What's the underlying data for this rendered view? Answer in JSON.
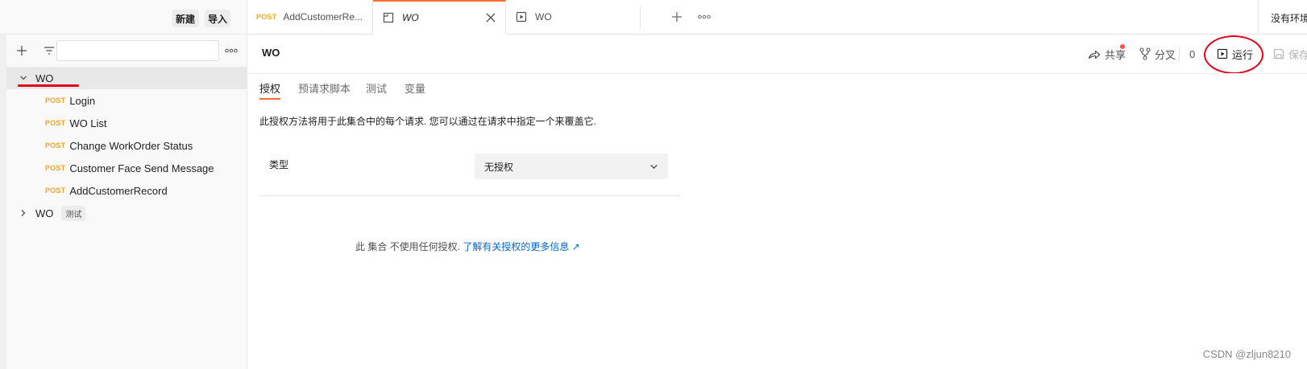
{
  "topbar": {
    "new_label": "新建",
    "import_label": "导入",
    "tabs": [
      {
        "method": "POST",
        "label": "AddCustomerRe..."
      },
      {
        "label": "WO"
      },
      {
        "label": "WO"
      }
    ],
    "env_label": "没有环境"
  },
  "sidebar": {
    "collections": [
      {
        "name": "WO",
        "expanded": true,
        "requests": [
          {
            "method": "POST",
            "name": "Login"
          },
          {
            "method": "POST",
            "name": "WO List"
          },
          {
            "method": "POST",
            "name": "Change WorkOrder Status"
          },
          {
            "method": "POST",
            "name": "Customer Face Send Message"
          },
          {
            "method": "POST",
            "name": "AddCustomerRecord"
          }
        ]
      },
      {
        "name": "WO",
        "badge": "测试",
        "expanded": false
      }
    ]
  },
  "main": {
    "title": "WO",
    "actions": {
      "share": "共享",
      "fork": "分叉",
      "fork_count": "0",
      "run": "运行",
      "save": "保存"
    },
    "tabs": [
      "授权",
      "预请求脚本",
      "测试",
      "变量"
    ],
    "active_tab": "授权",
    "auth": {
      "description": "此授权方法将用于此集合中的每个请求. 您可以通过在请求中指定一个来覆盖它.",
      "type_label": "类型",
      "type_value": "无授权",
      "info_text": "此 集合 不使用任何授权.",
      "info_link": "了解有关授权的更多信息 ↗"
    }
  },
  "watermark": "CSDN @zljun8210",
  "colors": {
    "accent": "#ff6c37",
    "post_method": "#f6a623",
    "link": "#0265d2",
    "annotation": "#e0001a"
  }
}
